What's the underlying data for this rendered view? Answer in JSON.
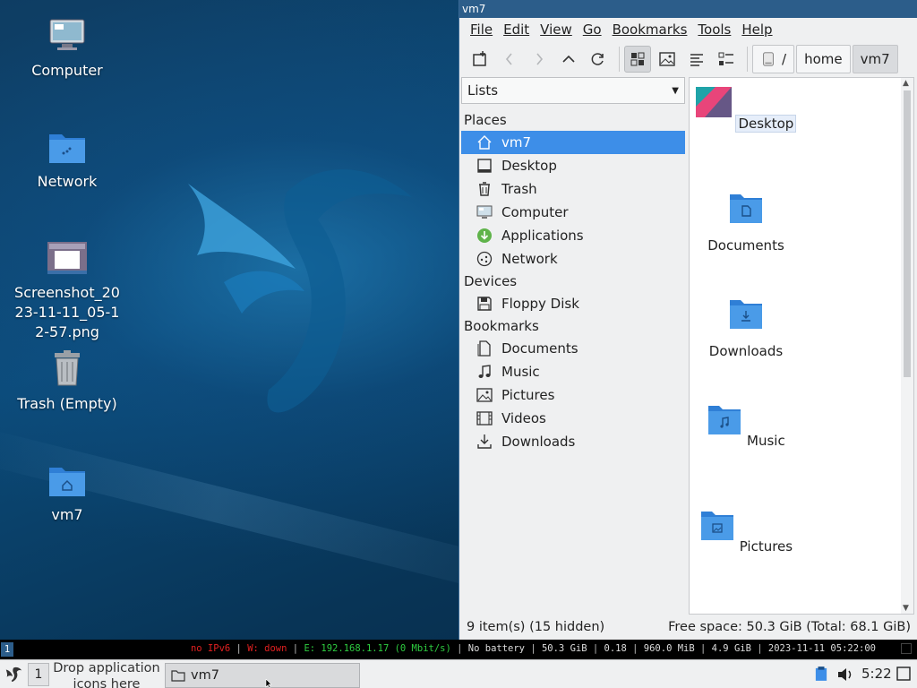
{
  "desktop": {
    "icons": [
      {
        "label": "Computer",
        "icon": "computer-icon"
      },
      {
        "label": "Network",
        "icon": "network-folder-icon"
      },
      {
        "label": "Screenshot_2023-11-11_05-12-57.png",
        "icon": "image-thumbnail-icon"
      },
      {
        "label": "Trash (Empty)",
        "icon": "trash-icon"
      },
      {
        "label": "vm7",
        "icon": "home-folder-icon"
      }
    ]
  },
  "window": {
    "title": "vm7",
    "menu": [
      "File",
      "Edit",
      "View",
      "Go",
      "Bookmarks",
      "Tools",
      "Help"
    ],
    "path": {
      "root": "/",
      "segments": [
        "home",
        "vm7"
      ]
    },
    "side_combo": "Lists",
    "places_heading": "Places",
    "places": [
      "vm7",
      "Desktop",
      "Trash",
      "Computer",
      "Applications",
      "Network"
    ],
    "devices_heading": "Devices",
    "devices": [
      "Floppy Disk"
    ],
    "bookmarks_heading": "Bookmarks",
    "bookmarks": [
      "Documents",
      "Music",
      "Pictures",
      "Videos",
      "Downloads"
    ],
    "files": [
      "Desktop",
      "Documents",
      "Downloads",
      "Music",
      "Pictures"
    ],
    "status_left": "9 item(s) (15 hidden)",
    "status_right": "Free space: 50.3 GiB (Total: 68.1 GiB)",
    "accent": "#3d8ee8"
  },
  "conky": {
    "workspace": "1",
    "ipv6": "no IPv6",
    "wifi": "W: down",
    "eth": "E: 192.168.1.17 (0 Mbit/s)",
    "battery": "No battery",
    "disk": "50.3 GiB",
    "load": "0.18",
    "mem": "960.0 MiB",
    "swap": "4.9 GiB",
    "datetime": "2023-11-11 05:22:00"
  },
  "taskbar": {
    "desktop_num": "1",
    "drop_hint": "Drop application icons here",
    "task": "vm7",
    "clock": "5:22"
  }
}
